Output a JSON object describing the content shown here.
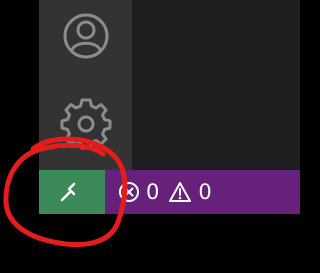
{
  "activity_bar": {
    "icons": [
      "account-icon",
      "gear-icon"
    ]
  },
  "status_bar": {
    "remote_icon": "remote-indicator-icon",
    "errors_count": "0",
    "warnings_count": "0"
  },
  "annotation": {
    "color": "#e41c1c"
  },
  "colors": {
    "activity_bar": "#333333",
    "status_bar": "#68217a",
    "remote_button": "#3c8a5a"
  }
}
